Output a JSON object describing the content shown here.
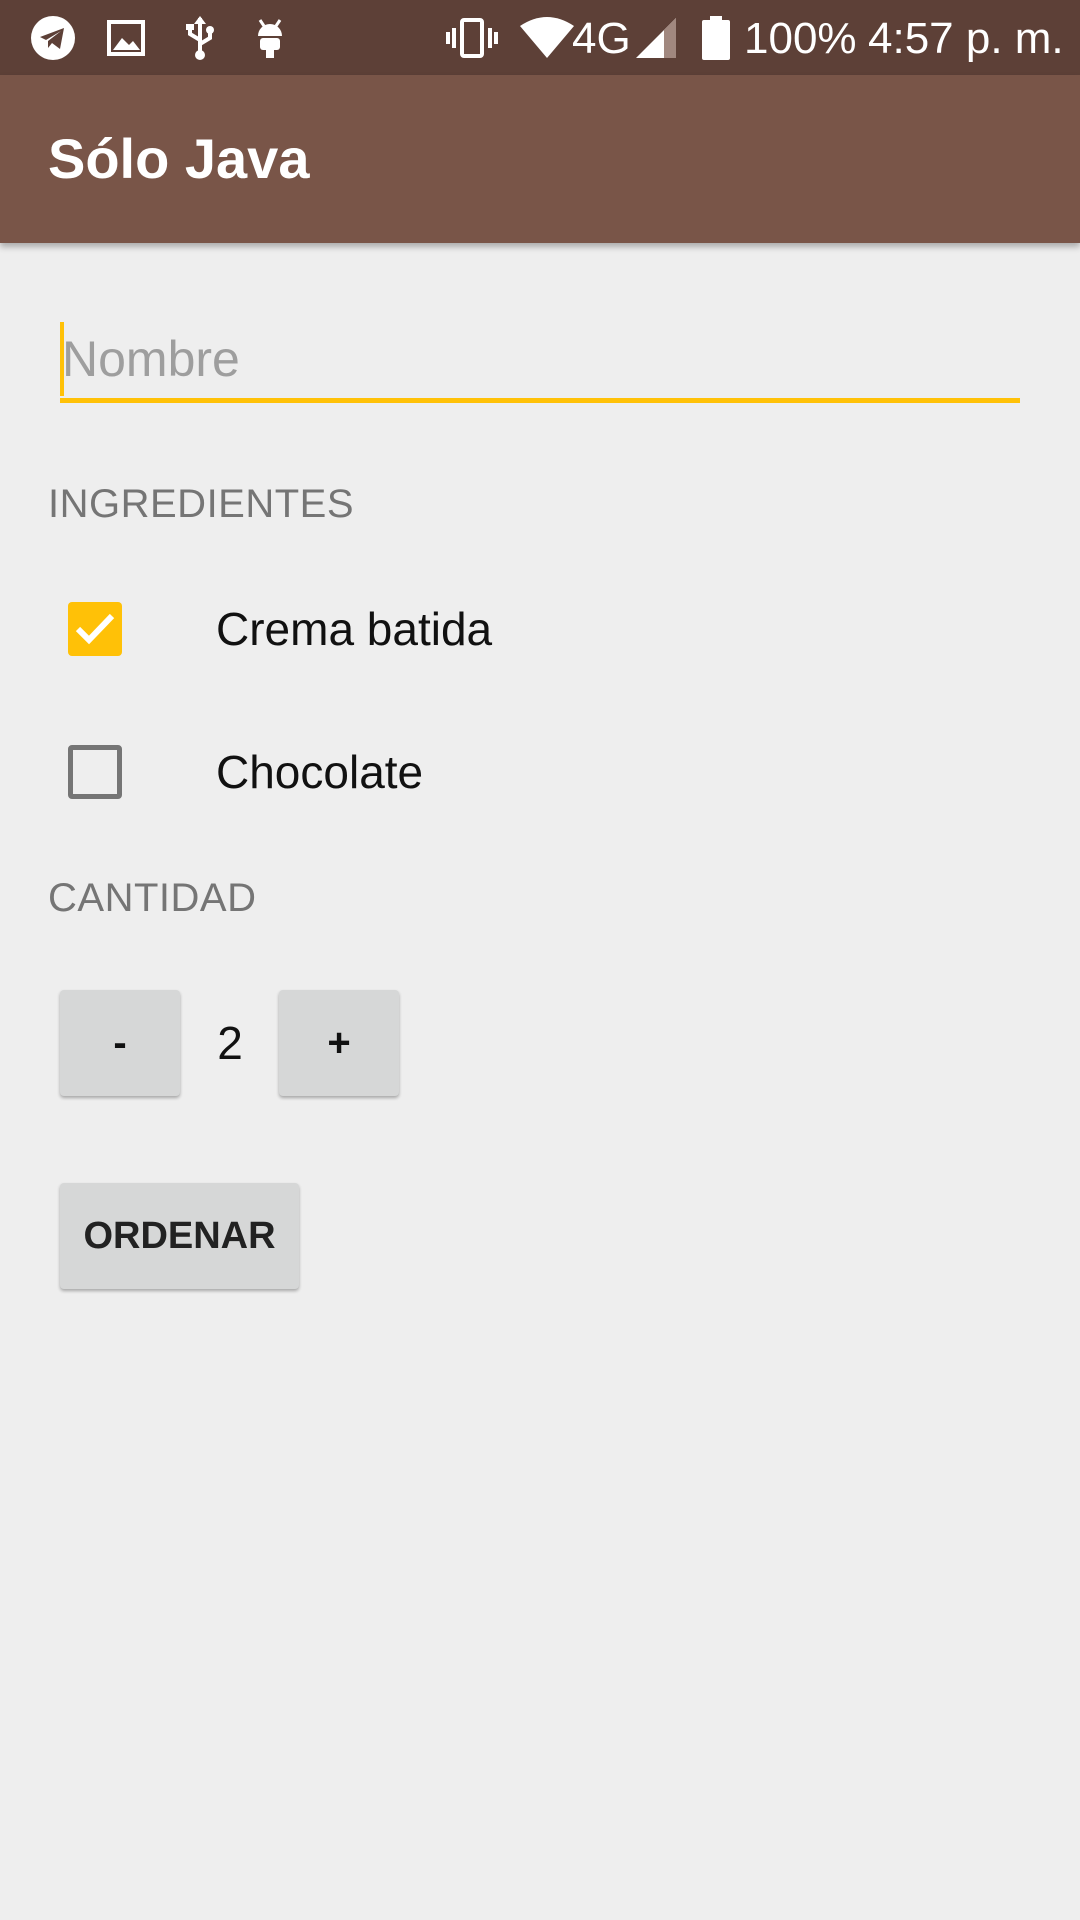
{
  "status_bar": {
    "icons_left": [
      "telegram-icon",
      "image-icon",
      "usb-icon",
      "android-icon"
    ],
    "icons_right": [
      "vibrate-icon",
      "wifi-icon",
      "signal-icon",
      "battery-icon"
    ],
    "network_label": "4G",
    "battery_percent": "100%",
    "time": "4:57 p. m."
  },
  "app_bar": {
    "title": "Sólo Java"
  },
  "form": {
    "name_placeholder": "Nombre",
    "name_value": "",
    "ingredients_label": "INGREDIENTES",
    "toppings": [
      {
        "label": "Crema batida",
        "checked": true
      },
      {
        "label": "Chocolate",
        "checked": false
      }
    ],
    "quantity_label": "CANTIDAD",
    "decrement_label": "-",
    "quantity_value": "2",
    "increment_label": "+",
    "order_button_label": "ORDENAR"
  },
  "colors": {
    "status_bar": "#5d4037",
    "app_bar": "#795548",
    "accent": "#ffc107",
    "background": "#eeeeee",
    "button": "#d6d7d7"
  }
}
